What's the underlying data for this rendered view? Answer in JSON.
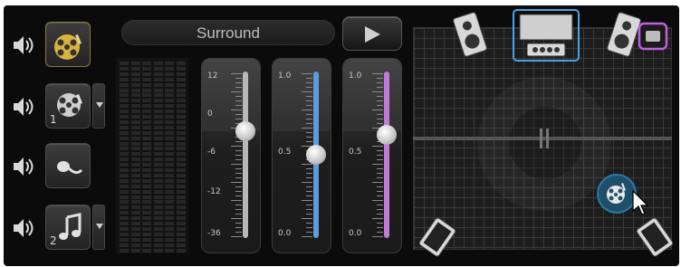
{
  "surround_label": "Surround",
  "tracks": [
    {
      "icon": "film-reel-icon",
      "number": "",
      "has_dropdown": false
    },
    {
      "icon": "film-reel-icon",
      "number": "1",
      "has_dropdown": true
    },
    {
      "icon": "microphone-icon",
      "number": "",
      "has_dropdown": false
    },
    {
      "icon": "music-note-icon",
      "number": "2",
      "has_dropdown": true
    }
  ],
  "sliders": [
    {
      "name": "volume",
      "labels": [
        "12",
        "0",
        "-6",
        "-12",
        "-36"
      ],
      "rail_color": "#b8b8b8",
      "level": 0.64
    },
    {
      "name": "level-blue",
      "labels": [
        "1.0",
        "0.5",
        "0.0"
      ],
      "rail_color": "#5b9be0",
      "level": 0.5
    },
    {
      "name": "level-purple",
      "labels": [
        "1.0",
        "0.5",
        "0.0"
      ],
      "rail_color": "#c07ad8",
      "level": 0.62
    }
  ],
  "colors": {
    "selected_front": "#4aa3e8",
    "selected_right": "#c060e0"
  }
}
